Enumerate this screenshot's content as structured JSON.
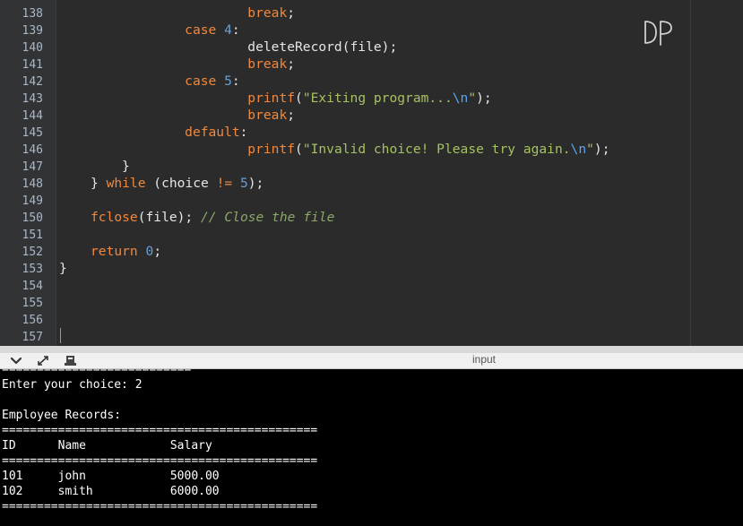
{
  "editor": {
    "watermark": "DP",
    "line_numbers": [
      "138",
      "139",
      "140",
      "141",
      "142",
      "143",
      "144",
      "145",
      "146",
      "147",
      "148",
      "149",
      "150",
      "151",
      "152",
      "153",
      "154",
      "155",
      "156",
      "157"
    ],
    "lines": [
      [
        {
          "t": "        ",
          "c": "pl"
        },
        {
          "t": "break",
          "c": "kw"
        },
        {
          "t": ";",
          "c": "pl"
        }
      ],
      [
        {
          "t": "    ",
          "c": "pl"
        },
        {
          "t": "case",
          "c": "kw"
        },
        {
          "t": " ",
          "c": "pl"
        },
        {
          "t": "4",
          "c": "num"
        },
        {
          "t": ":",
          "c": "pl"
        }
      ],
      [
        {
          "t": "        deleteRecord(file);",
          "c": "pl"
        }
      ],
      [
        {
          "t": "        ",
          "c": "pl"
        },
        {
          "t": "break",
          "c": "kw"
        },
        {
          "t": ";",
          "c": "pl"
        }
      ],
      [
        {
          "t": "    ",
          "c": "pl"
        },
        {
          "t": "case",
          "c": "kw"
        },
        {
          "t": " ",
          "c": "pl"
        },
        {
          "t": "5",
          "c": "num"
        },
        {
          "t": ":",
          "c": "pl"
        }
      ],
      [
        {
          "t": "        ",
          "c": "pl"
        },
        {
          "t": "printf",
          "c": "kw"
        },
        {
          "t": "(",
          "c": "pl"
        },
        {
          "t": "\"Exiting program...",
          "c": "str"
        },
        {
          "t": "\\n",
          "c": "esc"
        },
        {
          "t": "\"",
          "c": "str"
        },
        {
          "t": ");",
          "c": "pl"
        }
      ],
      [
        {
          "t": "        ",
          "c": "pl"
        },
        {
          "t": "break",
          "c": "kw"
        },
        {
          "t": ";",
          "c": "pl"
        }
      ],
      [
        {
          "t": "    ",
          "c": "pl"
        },
        {
          "t": "default",
          "c": "kw"
        },
        {
          "t": ":",
          "c": "pl"
        }
      ],
      [
        {
          "t": "        ",
          "c": "pl"
        },
        {
          "t": "printf",
          "c": "kw"
        },
        {
          "t": "(",
          "c": "pl"
        },
        {
          "t": "\"Invalid choice! Please try again.",
          "c": "str"
        },
        {
          "t": "\\n",
          "c": "esc"
        },
        {
          "t": "\"",
          "c": "str"
        },
        {
          "t": ");",
          "c": "pl"
        }
      ],
      [
        {
          "t": "}",
          "c": "pl"
        }
      ],
      [
        {
          "t": "} ",
          "c": "pl"
        },
        {
          "t": "while",
          "c": "kw"
        },
        {
          "t": " (choice ",
          "c": "pl"
        },
        {
          "t": "!=",
          "c": "kw"
        },
        {
          "t": " ",
          "c": "pl"
        },
        {
          "t": "5",
          "c": "num"
        },
        {
          "t": ");",
          "c": "pl"
        }
      ],
      [],
      [
        {
          "t": "fclose",
          "c": "kw"
        },
        {
          "t": "(file); ",
          "c": "pl"
        },
        {
          "t": "// Close the file",
          "c": "cm"
        }
      ],
      [],
      [
        {
          "t": "return",
          "c": "kw"
        },
        {
          "t": " ",
          "c": "pl"
        },
        {
          "t": "0",
          "c": "num"
        },
        {
          "t": ";",
          "c": "pl"
        }
      ],
      [
        {
          "t": "}",
          "c": "pl"
        }
      ],
      [],
      [],
      [],
      []
    ]
  },
  "panel": {
    "title": "input",
    "buttons": [
      "chevron-down-icon",
      "expand-icon",
      "terminal-icon"
    ]
  },
  "console": {
    "lines": [
      "===========================",
      "Enter your choice: 2",
      "",
      "Employee Records:",
      "=============================================",
      "ID      Name            Salary",
      "=============================================",
      "101     john            5000.00",
      "102     smith           6000.00",
      "============================================="
    ]
  },
  "colors": {
    "editor_bg": "#2b2b2b",
    "keyword": "#f0883e",
    "number": "#6a9fd4",
    "string": "#a5c261",
    "comment": "#8aa86a",
    "console_bg": "#000000"
  }
}
